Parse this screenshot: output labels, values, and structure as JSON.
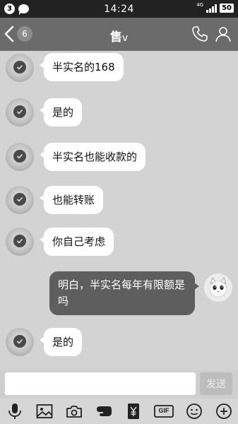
{
  "status_bar": {
    "notification_count": "3",
    "time": "14:24",
    "network": "4G",
    "battery": "50"
  },
  "header": {
    "back_count": "6",
    "title": "售",
    "title_suffix": "v"
  },
  "messages": [
    {
      "from": "other",
      "text": "半实名的168"
    },
    {
      "from": "other",
      "text": "是的"
    },
    {
      "from": "other",
      "text": "半实名也能收款的"
    },
    {
      "from": "other",
      "text": "也能转账"
    },
    {
      "from": "other",
      "text": "你自己考虑"
    },
    {
      "from": "self",
      "text": "明白，半实名每年有限额是吗"
    },
    {
      "from": "other",
      "text": "是的"
    }
  ],
  "input": {
    "value": "",
    "send_label": "发送"
  },
  "toolbar": {
    "gif_label": "GIF",
    "icons": [
      "microphone-icon",
      "image-icon",
      "camera-icon",
      "shake-icon",
      "red-packet-icon",
      "gif-icon",
      "emoji-icon",
      "plus-icon"
    ]
  },
  "colors": {
    "status_bar": "#222222",
    "title_bar": "#6b6b6b",
    "background": "#d3d3d3",
    "bubble_other": "#ffffff",
    "bubble_self": "#5e5e5e"
  }
}
